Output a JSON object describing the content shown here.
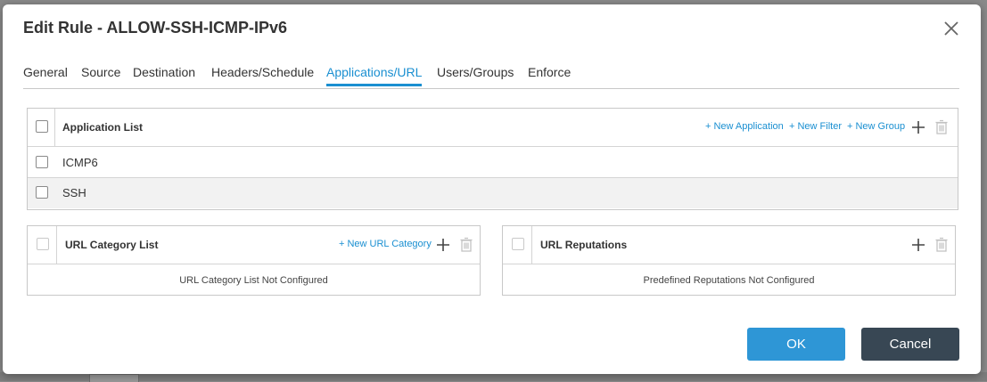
{
  "dialog": {
    "title": "Edit Rule - ALLOW-SSH-ICMP-IPv6"
  },
  "tabs": [
    {
      "label": "General"
    },
    {
      "label": "Source"
    },
    {
      "label": "Destination"
    },
    {
      "label": "Headers/Schedule"
    },
    {
      "label": "Applications/URL"
    },
    {
      "label": "Users/Groups"
    },
    {
      "label": "Enforce"
    }
  ],
  "active_tab": "Applications/URL",
  "application_panel": {
    "title": "Application List",
    "new_application": "+ New Application",
    "new_filter": "+ New Filter",
    "new_group": "+ New Group",
    "rows": [
      {
        "name": "ICMP6"
      },
      {
        "name": "SSH"
      }
    ]
  },
  "url_category_panel": {
    "title": "URL Category List",
    "new_url_category": "+ New URL Category",
    "empty_message": "URL Category List Not Configured"
  },
  "url_reputation_panel": {
    "title": "URL Reputations",
    "empty_message": "Predefined Reputations Not Configured"
  },
  "buttons": {
    "ok": "OK",
    "cancel": "Cancel"
  },
  "colors": {
    "accent": "#1a8fd1",
    "ok_button": "#2e96d6",
    "cancel_button": "#384754"
  },
  "icons": {
    "close": "close-icon",
    "add": "plus-icon",
    "delete": "trash-icon"
  }
}
